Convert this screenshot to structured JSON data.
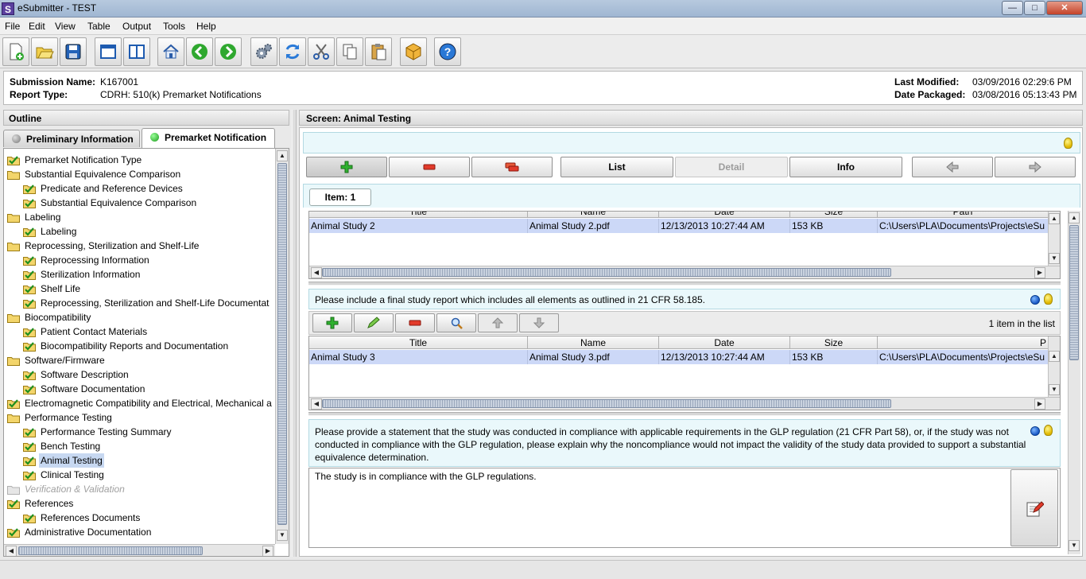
{
  "window": {
    "title": "eSubmitter - TEST",
    "app_icon_letter": "S",
    "minimize": "—",
    "maximize": "□",
    "close": "✕"
  },
  "menubar": [
    "File",
    "Edit",
    "View",
    "Table",
    "Output",
    "Tools",
    "Help"
  ],
  "toolbar": [
    "new-document-icon",
    "open-folder-icon",
    "save-icon",
    "single-window-icon",
    "split-window-icon",
    "home-icon",
    "back-arrow-icon",
    "forward-arrow-icon",
    "settings-gears-icon",
    "refresh-icon",
    "cut-scissors-icon",
    "copy-icon",
    "paste-icon",
    "package-icon",
    "help-icon"
  ],
  "submission": {
    "name_label": "Submission Name:",
    "name": "K167001",
    "type_label": "Report Type:",
    "type": "CDRH: 510(k) Premarket Notifications",
    "modified_label": "Last Modified:",
    "modified": "03/09/2016 02:29:6 PM",
    "packaged_label": "Date Packaged:",
    "packaged": "03/08/2016 05:13:43 PM"
  },
  "outline": {
    "title": "Outline",
    "tabs": [
      {
        "label": "Preliminary Information",
        "status_color": "#888888"
      },
      {
        "label": "Premarket Notification",
        "status_color": "#22b422"
      }
    ],
    "tree": [
      {
        "label": "Premarket Notification Type",
        "level": 0,
        "icon": "check",
        "state": ""
      },
      {
        "label": "Substantial Equivalence Comparison",
        "level": 0,
        "icon": "folder",
        "state": ""
      },
      {
        "label": "Predicate and Reference Devices",
        "level": 1,
        "icon": "check",
        "state": ""
      },
      {
        "label": "Substantial Equivalence Comparison",
        "level": 1,
        "icon": "check",
        "state": ""
      },
      {
        "label": "Labeling",
        "level": 0,
        "icon": "folder",
        "state": ""
      },
      {
        "label": "Labeling",
        "level": 1,
        "icon": "check",
        "state": ""
      },
      {
        "label": "Reprocessing, Sterilization and Shelf-Life",
        "level": 0,
        "icon": "folder",
        "state": ""
      },
      {
        "label": "Reprocessing Information",
        "level": 1,
        "icon": "check",
        "state": ""
      },
      {
        "label": "Sterilization Information",
        "level": 1,
        "icon": "check",
        "state": ""
      },
      {
        "label": "Shelf Life",
        "level": 1,
        "icon": "check",
        "state": ""
      },
      {
        "label": "Reprocessing, Sterilization and Shelf-Life Documentat",
        "level": 1,
        "icon": "check",
        "state": ""
      },
      {
        "label": "Biocompatibility",
        "level": 0,
        "icon": "folder",
        "state": ""
      },
      {
        "label": "Patient Contact Materials",
        "level": 1,
        "icon": "check",
        "state": ""
      },
      {
        "label": "Biocompatibility Reports and Documentation",
        "level": 1,
        "icon": "check",
        "state": ""
      },
      {
        "label": "Software/Firmware",
        "level": 0,
        "icon": "folder",
        "state": ""
      },
      {
        "label": "Software Description",
        "level": 1,
        "icon": "check",
        "state": ""
      },
      {
        "label": "Software Documentation",
        "level": 1,
        "icon": "check",
        "state": ""
      },
      {
        "label": "Electromagnetic Compatibility and Electrical, Mechanical a",
        "level": 0,
        "icon": "check",
        "state": ""
      },
      {
        "label": "Performance Testing",
        "level": 0,
        "icon": "folder",
        "state": ""
      },
      {
        "label": "Performance Testing Summary",
        "level": 1,
        "icon": "check",
        "state": ""
      },
      {
        "label": "Bench Testing",
        "level": 1,
        "icon": "check",
        "state": ""
      },
      {
        "label": "Animal Testing",
        "level": 1,
        "icon": "check",
        "state": "selected"
      },
      {
        "label": "Clinical Testing",
        "level": 1,
        "icon": "check",
        "state": ""
      },
      {
        "label": "Verification & Validation",
        "level": 0,
        "icon": "folder-grey",
        "state": "disabled"
      },
      {
        "label": "References",
        "level": 0,
        "icon": "check",
        "state": ""
      },
      {
        "label": "References Documents",
        "level": 1,
        "icon": "check",
        "state": ""
      },
      {
        "label": "Administrative Documentation",
        "level": 0,
        "icon": "check",
        "state": ""
      }
    ]
  },
  "screen": {
    "title": "Screen: Animal Testing",
    "nav_buttons": {
      "add_icon": "plus-icon",
      "remove_icon": "minus-icon",
      "copy_icon": "duplicate-icon",
      "list": "List",
      "detail": "Detail",
      "info": "Info",
      "prev_icon": "arrow-left-icon",
      "next_icon": "arrow-right-icon"
    },
    "item_tab": "Item: 1",
    "grid1": {
      "columns": [
        "Title",
        "Name",
        "Date",
        "Size",
        "Path"
      ],
      "rows": [
        [
          "Animal Study 2",
          "Animal Study 2.pdf",
          "12/13/2013 10:27:44 AM",
          "153 KB",
          "C:\\Users\\PLA\\Documents\\Projects\\eSu"
        ]
      ]
    },
    "question1": "Please include a final study report which includes all elements as outlined in 21 CFR 58.185.",
    "grid2_count": "1 item in the list",
    "grid2": {
      "columns": [
        "Title",
        "Name",
        "Date",
        "Size",
        "P"
      ],
      "rows": [
        [
          "Animal Study 3",
          "Animal Study 3.pdf",
          "12/13/2013 10:27:44 AM",
          "153 KB",
          "C:\\Users\\PLA\\Documents\\Projects\\eSu"
        ]
      ]
    },
    "question2": "Please provide a statement that the study was conducted in compliance with applicable requirements in the GLP regulation (21 CFR Part 58), or, if the study was not conducted in compliance with the GLP regulation, please explain why the noncompliance would not impact the validity of the study data provided to support a substantial equivalence determination.",
    "answer2": "The study is in compliance with the GLP regulations."
  },
  "colors": {
    "selection": "#c7d8f1",
    "row_highlight": "#ccd8f7",
    "info_bar": "#eaf8fb"
  }
}
